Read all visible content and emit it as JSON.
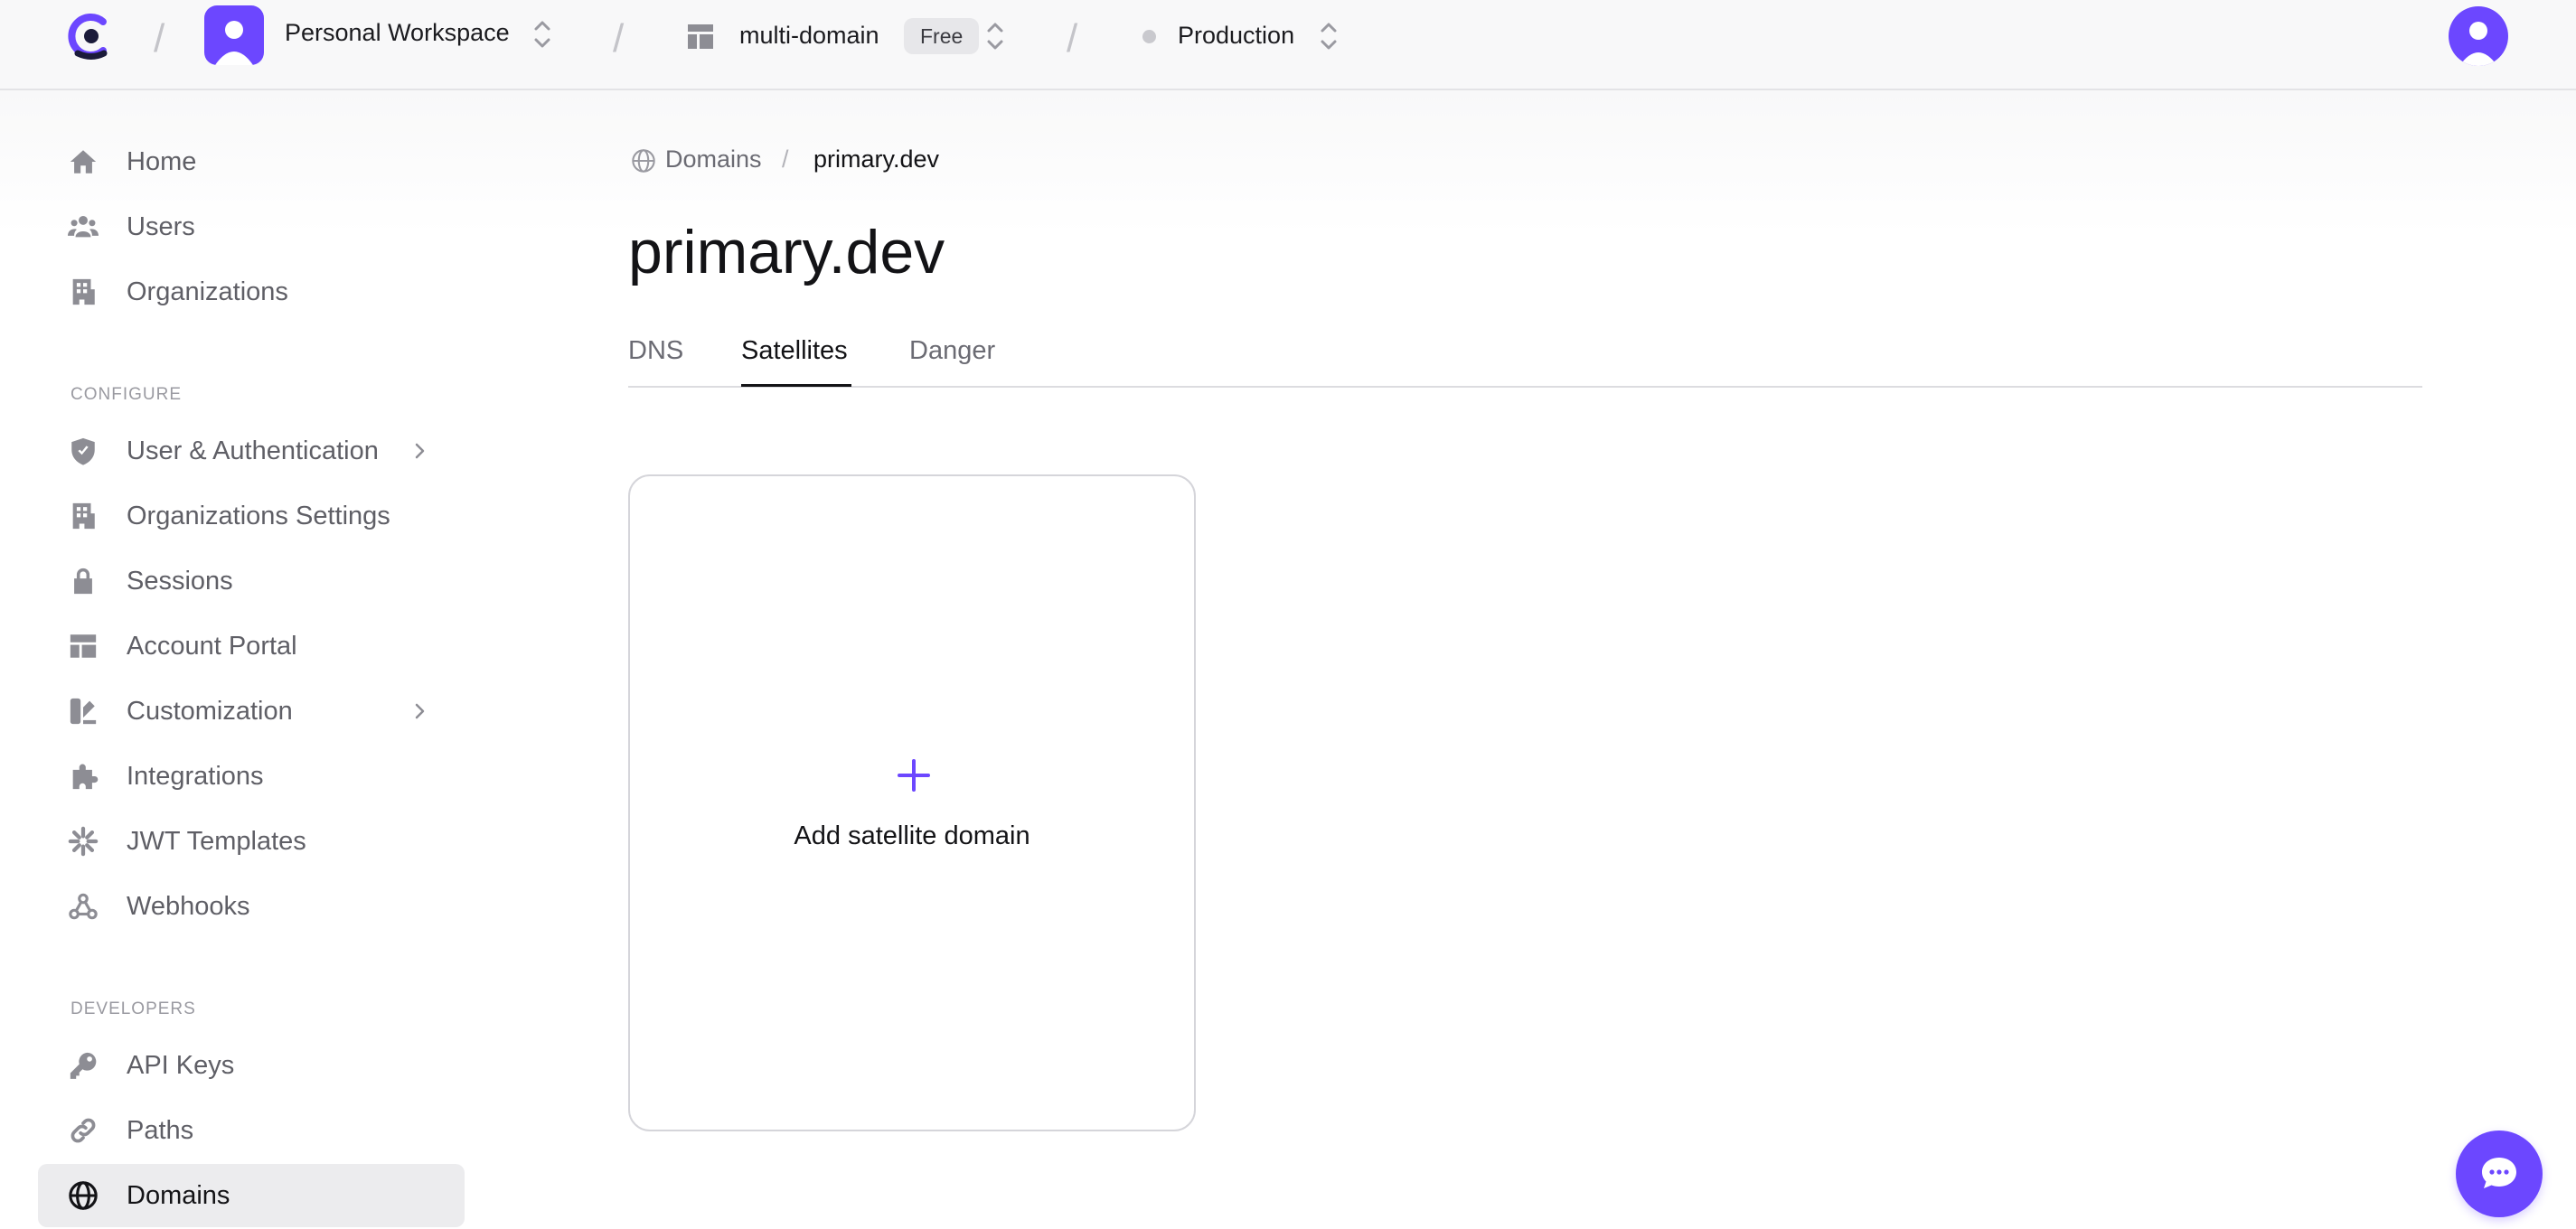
{
  "topbar": {
    "workspace_name": "Personal Workspace",
    "app_name": "multi-domain",
    "plan_badge": "Free",
    "environment": "Production"
  },
  "sidebar": {
    "items_top": [
      {
        "label": "Home",
        "icon": "home-icon"
      },
      {
        "label": "Users",
        "icon": "users-icon"
      },
      {
        "label": "Organizations",
        "icon": "building-icon"
      }
    ],
    "configure_label": "CONFIGURE",
    "configure_items": [
      {
        "label": "User & Authentication",
        "icon": "shield-icon",
        "has_chevron": true
      },
      {
        "label": "Organizations Settings",
        "icon": "building-icon"
      },
      {
        "label": "Sessions",
        "icon": "lock-icon"
      },
      {
        "label": "Account Portal",
        "icon": "layout-icon"
      },
      {
        "label": "Customization",
        "icon": "paint-icon",
        "has_chevron": true
      },
      {
        "label": "Integrations",
        "icon": "puzzle-icon"
      },
      {
        "label": "JWT Templates",
        "icon": "asterisk-icon"
      },
      {
        "label": "Webhooks",
        "icon": "webhook-icon"
      }
    ],
    "developers_label": "DEVELOPERS",
    "developer_items": [
      {
        "label": "API Keys",
        "icon": "key-icon"
      },
      {
        "label": "Paths",
        "icon": "link-icon"
      },
      {
        "label": "Domains",
        "icon": "globe-icon",
        "active": true
      }
    ]
  },
  "breadcrumb": {
    "parent": "Domains",
    "separator": "/",
    "current": "primary.dev"
  },
  "page": {
    "title": "primary.dev",
    "tabs": [
      {
        "label": "DNS"
      },
      {
        "label": "Satellites",
        "active": true
      },
      {
        "label": "Danger"
      }
    ],
    "add_card_label": "Add satellite domain"
  },
  "colors": {
    "accent": "#6c47ff",
    "active_item_bg": "#ececee"
  }
}
